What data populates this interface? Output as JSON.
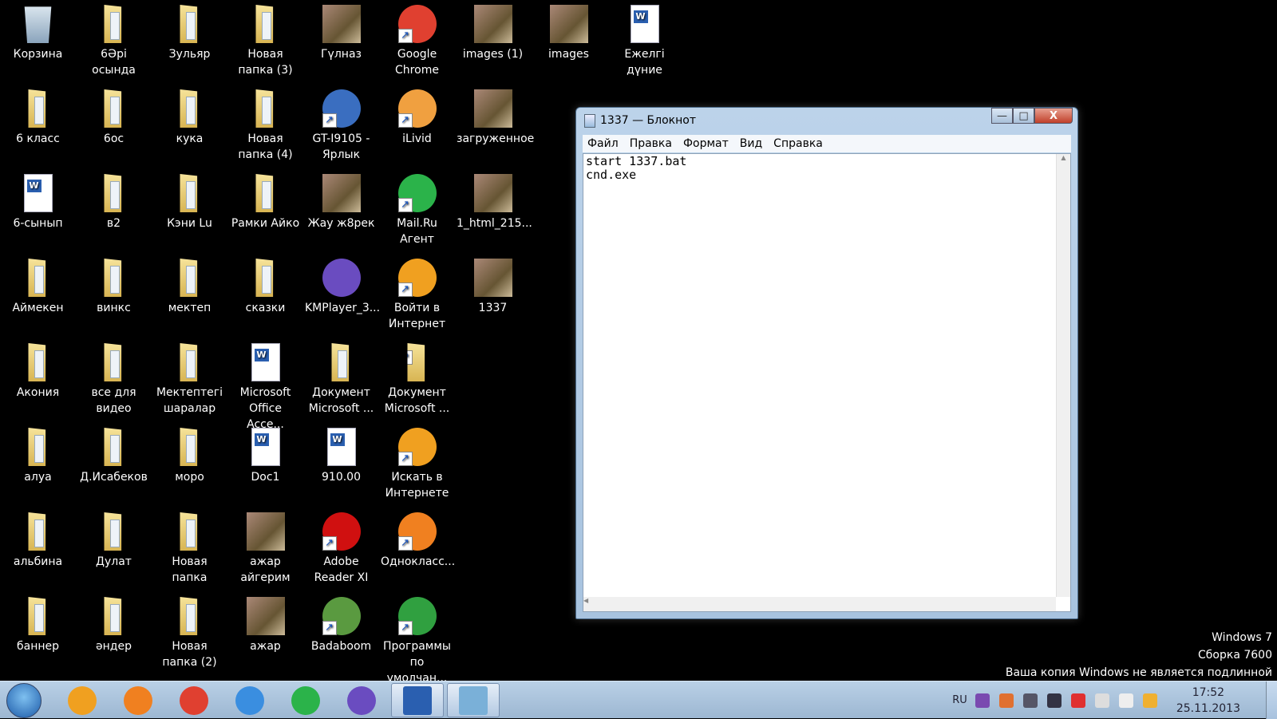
{
  "desktop": {
    "icons": [
      {
        "label": "Корзина",
        "kind": "recycle",
        "col": 0,
        "row": 0
      },
      {
        "label": "6Әрі осында",
        "kind": "folder",
        "col": 1,
        "row": 0
      },
      {
        "label": "Зульяр",
        "kind": "folder",
        "col": 2,
        "row": 0
      },
      {
        "label": "Новая папка (3)",
        "kind": "folder",
        "col": 3,
        "row": 0
      },
      {
        "label": "Гүлназ",
        "kind": "pic",
        "col": 4,
        "row": 0
      },
      {
        "label": "Google Chrome",
        "kind": "app",
        "color": "#e04030",
        "short": true,
        "col": 5,
        "row": 0
      },
      {
        "label": "images (1)",
        "kind": "pic",
        "col": 6,
        "row": 0
      },
      {
        "label": "images",
        "kind": "pic",
        "col": 7,
        "row": 0
      },
      {
        "label": "Ежелгі дүние",
        "kind": "doc",
        "col": 8,
        "row": 0
      },
      {
        "label": "6 класс",
        "kind": "folder",
        "col": 0,
        "row": 1
      },
      {
        "label": "6ос",
        "kind": "folder",
        "col": 1,
        "row": 1
      },
      {
        "label": "кука",
        "kind": "folder",
        "col": 2,
        "row": 1
      },
      {
        "label": "Новая папка (4)",
        "kind": "folder",
        "col": 3,
        "row": 1
      },
      {
        "label": "GT-I9105 - Ярлык",
        "kind": "app",
        "color": "#3a6ec0",
        "short": true,
        "col": 4,
        "row": 1
      },
      {
        "label": "iLivid",
        "kind": "app",
        "color": "#f0a040",
        "short": true,
        "col": 5,
        "row": 1
      },
      {
        "label": "загруженное",
        "kind": "pic",
        "col": 6,
        "row": 1
      },
      {
        "label": "6-сынып",
        "kind": "doc",
        "col": 0,
        "row": 2
      },
      {
        "label": "в2",
        "kind": "folder",
        "col": 1,
        "row": 2
      },
      {
        "label": "Кэни Lu",
        "kind": "folder",
        "col": 2,
        "row": 2
      },
      {
        "label": "Рамки Айко",
        "kind": "folder",
        "col": 3,
        "row": 2
      },
      {
        "label": "Жау ж8рек",
        "kind": "pic",
        "col": 4,
        "row": 2
      },
      {
        "label": "Mail.Ru Агент",
        "kind": "app",
        "color": "#2bb34a",
        "short": true,
        "col": 5,
        "row": 2
      },
      {
        "label": "1_html_215...",
        "kind": "pic",
        "col": 6,
        "row": 2
      },
      {
        "label": "Аймекен",
        "kind": "folder",
        "col": 0,
        "row": 3
      },
      {
        "label": "винкс",
        "kind": "folder",
        "col": 1,
        "row": 3
      },
      {
        "label": "мектеп",
        "kind": "folder",
        "col": 2,
        "row": 3
      },
      {
        "label": "сказки",
        "kind": "folder",
        "col": 3,
        "row": 3
      },
      {
        "label": "KMPlayer_3...",
        "kind": "app",
        "color": "#6a4cc0",
        "col": 4,
        "row": 3
      },
      {
        "label": "Войти в Интернет",
        "kind": "app",
        "color": "#f0a020",
        "short": true,
        "col": 5,
        "row": 3
      },
      {
        "label": "1337",
        "kind": "pic",
        "col": 6,
        "row": 3
      },
      {
        "label": "Акония",
        "kind": "folder",
        "col": 0,
        "row": 4
      },
      {
        "label": "все для видео",
        "kind": "folder",
        "col": 1,
        "row": 4
      },
      {
        "label": "Мектептегі шаралар",
        "kind": "folder",
        "col": 2,
        "row": 4
      },
      {
        "label": "Microsoft Office Acce...",
        "kind": "doc",
        "col": 3,
        "row": 4
      },
      {
        "label": "Документ Microsoft ...",
        "kind": "folder",
        "col": 4,
        "row": 4
      },
      {
        "label": "Документ Microsoft ...",
        "kind": "folder",
        "short": true,
        "col": 5,
        "row": 4
      },
      {
        "label": "алуа",
        "kind": "folder",
        "col": 0,
        "row": 5
      },
      {
        "label": "Д.Исабеков",
        "kind": "folder",
        "col": 1,
        "row": 5
      },
      {
        "label": "моро",
        "kind": "folder",
        "col": 2,
        "row": 5
      },
      {
        "label": "Doc1",
        "kind": "doc",
        "col": 3,
        "row": 5
      },
      {
        "label": "910.00",
        "kind": "doc",
        "col": 4,
        "row": 5
      },
      {
        "label": "Искать в Интернете",
        "kind": "app",
        "color": "#f0a020",
        "short": true,
        "col": 5,
        "row": 5
      },
      {
        "label": "альбина",
        "kind": "folder",
        "col": 0,
        "row": 6
      },
      {
        "label": "Дулат",
        "kind": "folder",
        "col": 1,
        "row": 6
      },
      {
        "label": "Новая папка",
        "kind": "folder",
        "col": 2,
        "row": 6
      },
      {
        "label": "ажар айгерим",
        "kind": "pic",
        "col": 3,
        "row": 6
      },
      {
        "label": "Adobe Reader XI",
        "kind": "app",
        "color": "#d01010",
        "short": true,
        "col": 4,
        "row": 6
      },
      {
        "label": "Однокласс...",
        "kind": "app",
        "color": "#f08020",
        "short": true,
        "col": 5,
        "row": 6
      },
      {
        "label": "баннер",
        "kind": "folder",
        "col": 0,
        "row": 7
      },
      {
        "label": "әндер",
        "kind": "folder",
        "col": 1,
        "row": 7
      },
      {
        "label": "Новая папка (2)",
        "kind": "folder",
        "col": 2,
        "row": 7
      },
      {
        "label": "ажар",
        "kind": "pic",
        "col": 3,
        "row": 7
      },
      {
        "label": "Badaboom",
        "kind": "app",
        "color": "#5a9a40",
        "short": true,
        "col": 4,
        "row": 7
      },
      {
        "label": "Программы по умолчан...",
        "kind": "app",
        "color": "#30a040",
        "short": true,
        "col": 5,
        "row": 7
      }
    ]
  },
  "notepad": {
    "title": "1337 — Блокнот",
    "menu": [
      "Файл",
      "Правка",
      "Формат",
      "Вид",
      "Справка"
    ],
    "content": "start 1337.bat\ncnd.exe",
    "close_glyph": "X",
    "min_glyph": "—",
    "max_glyph": "□"
  },
  "watermark": {
    "line1": "Windows 7",
    "line2": "Сборка 7600",
    "line3": "Ваша копия Windows не является подлинной"
  },
  "taskbar": {
    "items": [
      {
        "name": "vojti-v-internet",
        "color": "#f0a020"
      },
      {
        "name": "odnoklassniki",
        "color": "#f08020"
      },
      {
        "name": "google-chrome",
        "color": "#e04030"
      },
      {
        "name": "internet-explorer",
        "color": "#3a8ee0"
      },
      {
        "name": "mail-ru-agent",
        "color": "#2bb34a"
      },
      {
        "name": "kmplayer",
        "color": "#6a4cc0"
      },
      {
        "name": "microsoft-word",
        "color": "#2a5fb0",
        "active": true
      },
      {
        "name": "notepad",
        "color": "#7ab0d8",
        "active": true
      }
    ],
    "lang": "RU",
    "tray_icons": [
      {
        "name": "onenote",
        "color": "#7a4ab0"
      },
      {
        "name": "sync",
        "color": "#e07030"
      },
      {
        "name": "usb",
        "color": "#556"
      },
      {
        "name": "network",
        "color": "#334"
      },
      {
        "name": "mail-agent",
        "color": "#e03030"
      },
      {
        "name": "action-center",
        "color": "#ddd"
      },
      {
        "name": "volume",
        "color": "#eee"
      },
      {
        "name": "windows-update",
        "color": "#f0b030"
      }
    ],
    "time": "17:52",
    "date": "25.11.2013"
  }
}
